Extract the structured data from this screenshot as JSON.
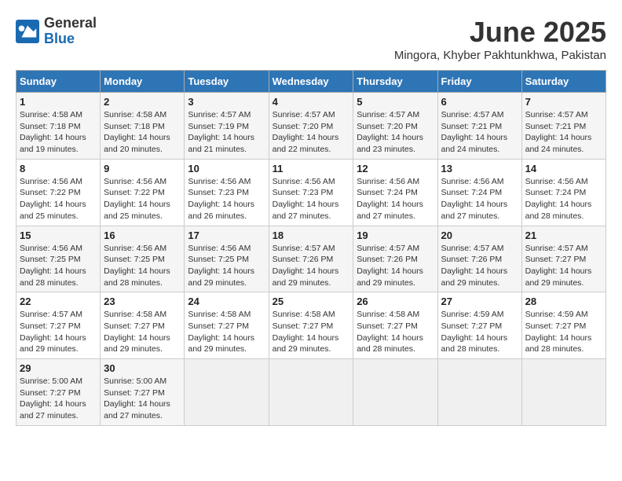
{
  "logo": {
    "general": "General",
    "blue": "Blue"
  },
  "title": "June 2025",
  "location": "Mingora, Khyber Pakhtunkhwa, Pakistan",
  "headers": [
    "Sunday",
    "Monday",
    "Tuesday",
    "Wednesday",
    "Thursday",
    "Friday",
    "Saturday"
  ],
  "weeks": [
    [
      {
        "day": "1",
        "info": "Sunrise: 4:58 AM\nSunset: 7:18 PM\nDaylight: 14 hours\nand 19 minutes."
      },
      {
        "day": "2",
        "info": "Sunrise: 4:58 AM\nSunset: 7:18 PM\nDaylight: 14 hours\nand 20 minutes."
      },
      {
        "day": "3",
        "info": "Sunrise: 4:57 AM\nSunset: 7:19 PM\nDaylight: 14 hours\nand 21 minutes."
      },
      {
        "day": "4",
        "info": "Sunrise: 4:57 AM\nSunset: 7:20 PM\nDaylight: 14 hours\nand 22 minutes."
      },
      {
        "day": "5",
        "info": "Sunrise: 4:57 AM\nSunset: 7:20 PM\nDaylight: 14 hours\nand 23 minutes."
      },
      {
        "day": "6",
        "info": "Sunrise: 4:57 AM\nSunset: 7:21 PM\nDaylight: 14 hours\nand 24 minutes."
      },
      {
        "day": "7",
        "info": "Sunrise: 4:57 AM\nSunset: 7:21 PM\nDaylight: 14 hours\nand 24 minutes."
      }
    ],
    [
      {
        "day": "8",
        "info": "Sunrise: 4:56 AM\nSunset: 7:22 PM\nDaylight: 14 hours\nand 25 minutes."
      },
      {
        "day": "9",
        "info": "Sunrise: 4:56 AM\nSunset: 7:22 PM\nDaylight: 14 hours\nand 25 minutes."
      },
      {
        "day": "10",
        "info": "Sunrise: 4:56 AM\nSunset: 7:23 PM\nDaylight: 14 hours\nand 26 minutes."
      },
      {
        "day": "11",
        "info": "Sunrise: 4:56 AM\nSunset: 7:23 PM\nDaylight: 14 hours\nand 27 minutes."
      },
      {
        "day": "12",
        "info": "Sunrise: 4:56 AM\nSunset: 7:24 PM\nDaylight: 14 hours\nand 27 minutes."
      },
      {
        "day": "13",
        "info": "Sunrise: 4:56 AM\nSunset: 7:24 PM\nDaylight: 14 hours\nand 27 minutes."
      },
      {
        "day": "14",
        "info": "Sunrise: 4:56 AM\nSunset: 7:24 PM\nDaylight: 14 hours\nand 28 minutes."
      }
    ],
    [
      {
        "day": "15",
        "info": "Sunrise: 4:56 AM\nSunset: 7:25 PM\nDaylight: 14 hours\nand 28 minutes."
      },
      {
        "day": "16",
        "info": "Sunrise: 4:56 AM\nSunset: 7:25 PM\nDaylight: 14 hours\nand 28 minutes."
      },
      {
        "day": "17",
        "info": "Sunrise: 4:56 AM\nSunset: 7:25 PM\nDaylight: 14 hours\nand 29 minutes."
      },
      {
        "day": "18",
        "info": "Sunrise: 4:57 AM\nSunset: 7:26 PM\nDaylight: 14 hours\nand 29 minutes."
      },
      {
        "day": "19",
        "info": "Sunrise: 4:57 AM\nSunset: 7:26 PM\nDaylight: 14 hours\nand 29 minutes."
      },
      {
        "day": "20",
        "info": "Sunrise: 4:57 AM\nSunset: 7:26 PM\nDaylight: 14 hours\nand 29 minutes."
      },
      {
        "day": "21",
        "info": "Sunrise: 4:57 AM\nSunset: 7:27 PM\nDaylight: 14 hours\nand 29 minutes."
      }
    ],
    [
      {
        "day": "22",
        "info": "Sunrise: 4:57 AM\nSunset: 7:27 PM\nDaylight: 14 hours\nand 29 minutes."
      },
      {
        "day": "23",
        "info": "Sunrise: 4:58 AM\nSunset: 7:27 PM\nDaylight: 14 hours\nand 29 minutes."
      },
      {
        "day": "24",
        "info": "Sunrise: 4:58 AM\nSunset: 7:27 PM\nDaylight: 14 hours\nand 29 minutes."
      },
      {
        "day": "25",
        "info": "Sunrise: 4:58 AM\nSunset: 7:27 PM\nDaylight: 14 hours\nand 29 minutes."
      },
      {
        "day": "26",
        "info": "Sunrise: 4:58 AM\nSunset: 7:27 PM\nDaylight: 14 hours\nand 28 minutes."
      },
      {
        "day": "27",
        "info": "Sunrise: 4:59 AM\nSunset: 7:27 PM\nDaylight: 14 hours\nand 28 minutes."
      },
      {
        "day": "28",
        "info": "Sunrise: 4:59 AM\nSunset: 7:27 PM\nDaylight: 14 hours\nand 28 minutes."
      }
    ],
    [
      {
        "day": "29",
        "info": "Sunrise: 5:00 AM\nSunset: 7:27 PM\nDaylight: 14 hours\nand 27 minutes."
      },
      {
        "day": "30",
        "info": "Sunrise: 5:00 AM\nSunset: 7:27 PM\nDaylight: 14 hours\nand 27 minutes."
      },
      {
        "day": "",
        "info": ""
      },
      {
        "day": "",
        "info": ""
      },
      {
        "day": "",
        "info": ""
      },
      {
        "day": "",
        "info": ""
      },
      {
        "day": "",
        "info": ""
      }
    ]
  ]
}
